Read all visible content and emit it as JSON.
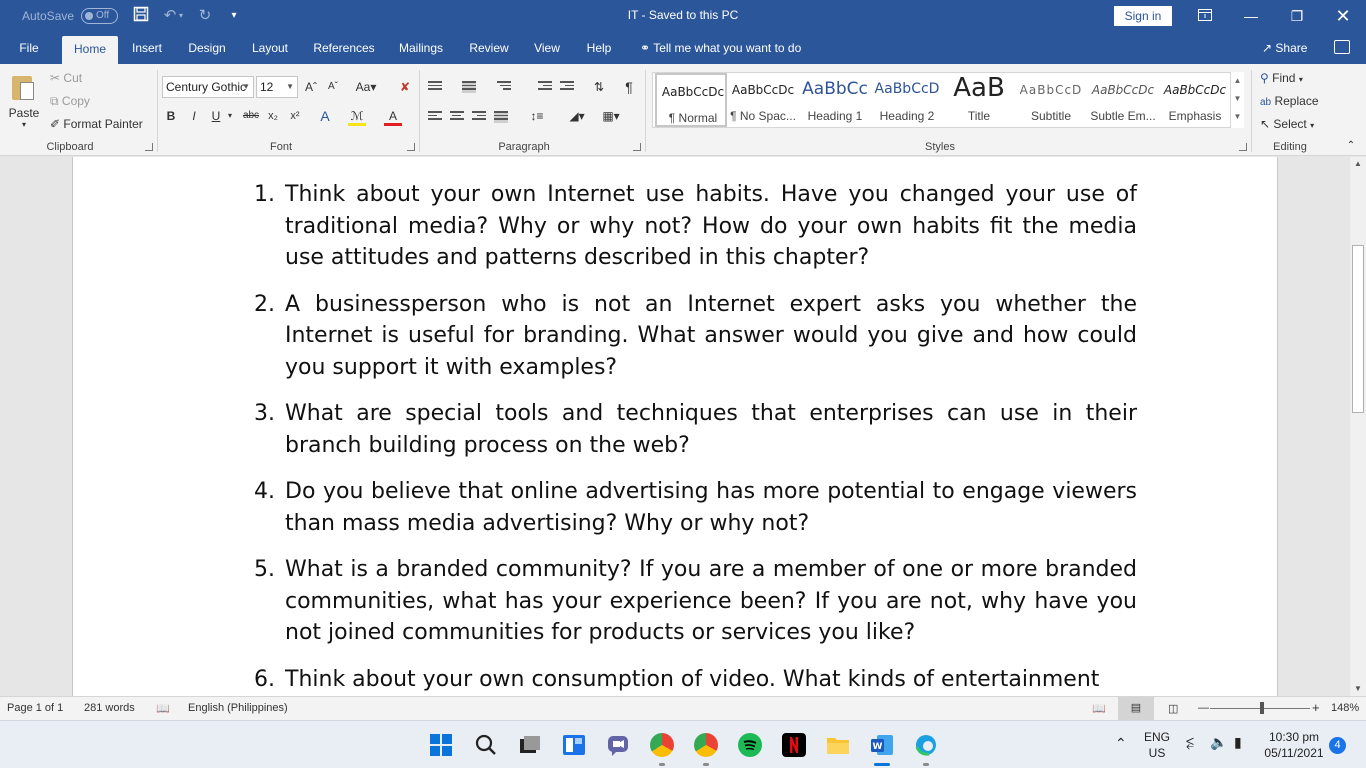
{
  "titlebar": {
    "autosave_label": "AutoSave",
    "autosave_state": "Off",
    "doc_title": "IT  -  Saved to this PC",
    "signin_label": "Sign in"
  },
  "tabs": [
    "File",
    "Home",
    "Insert",
    "Design",
    "Layout",
    "References",
    "Mailings",
    "Review",
    "View",
    "Help"
  ],
  "tell_me": "Tell me what you want to do",
  "share_label": "Share",
  "ribbon": {
    "clipboard": {
      "paste": "Paste",
      "cut": "Cut",
      "copy": "Copy",
      "format_painter": "Format Painter",
      "group_label": "Clipboard"
    },
    "font": {
      "font_name": "Century Gothic",
      "font_size": "12",
      "group_label": "Font"
    },
    "paragraph": {
      "group_label": "Paragraph"
    },
    "styles": {
      "items": [
        {
          "sample": "AaBbCcDc",
          "name": "¶ Normal"
        },
        {
          "sample": "AaBbCcDc",
          "name": "¶ No Spac..."
        },
        {
          "sample": "AaBbCc",
          "name": "Heading 1"
        },
        {
          "sample": "AaBbCcD",
          "name": "Heading 2"
        },
        {
          "sample": "AaB",
          "name": "Title"
        },
        {
          "sample": "AaBbCcD",
          "name": "Subtitle"
        },
        {
          "sample": "AaBbCcDc",
          "name": "Subtle Em..."
        },
        {
          "sample": "AaBbCcDc",
          "name": "Emphasis"
        }
      ],
      "group_label": "Styles"
    },
    "editing": {
      "find": "Find",
      "replace": "Replace",
      "select": "Select",
      "group_label": "Editing"
    }
  },
  "document": {
    "questions": [
      {
        "num": "1.",
        "text": "Think about your own Internet use habits. Have you changed your use of traditional media? Why or why not? How do your own habits fit the media use attitudes and patterns described in this chapter?"
      },
      {
        "num": "2.",
        "text": "A businessperson who is not an Internet expert asks you whether the Internet is useful for branding. What answer would you give and how could you support it with examples?"
      },
      {
        "num": "3.",
        "text": "What are special tools and techniques that enterprises can use in their branch building process on the web?"
      },
      {
        "num": "4.",
        "text": "Do you believe that online advertising has more potential to engage viewers than mass media advertising? Why or why not?"
      },
      {
        "num": "5.",
        "text": "What is a branded community? If you are a member of one or more branded communities, what has your experience been? If you are not, why have you not joined communities for products or services you like?"
      },
      {
        "num": "6.",
        "text": "Think about your own consumption of video. What kinds of entertainment"
      }
    ]
  },
  "statusbar": {
    "page": "Page 1 of 1",
    "words": "281 words",
    "language": "English (Philippines)",
    "zoom": "148%",
    "zoom_level": 0.52
  },
  "taskbar": {
    "lang_top": "ENG",
    "lang_bottom": "US",
    "time": "10:30 pm",
    "date": "05/11/2021",
    "notifications": "4"
  },
  "colors": {
    "word_blue": "#2b579a",
    "ribbon_bg": "#f3f3f3",
    "canvas_bg": "#e6e6e6"
  }
}
